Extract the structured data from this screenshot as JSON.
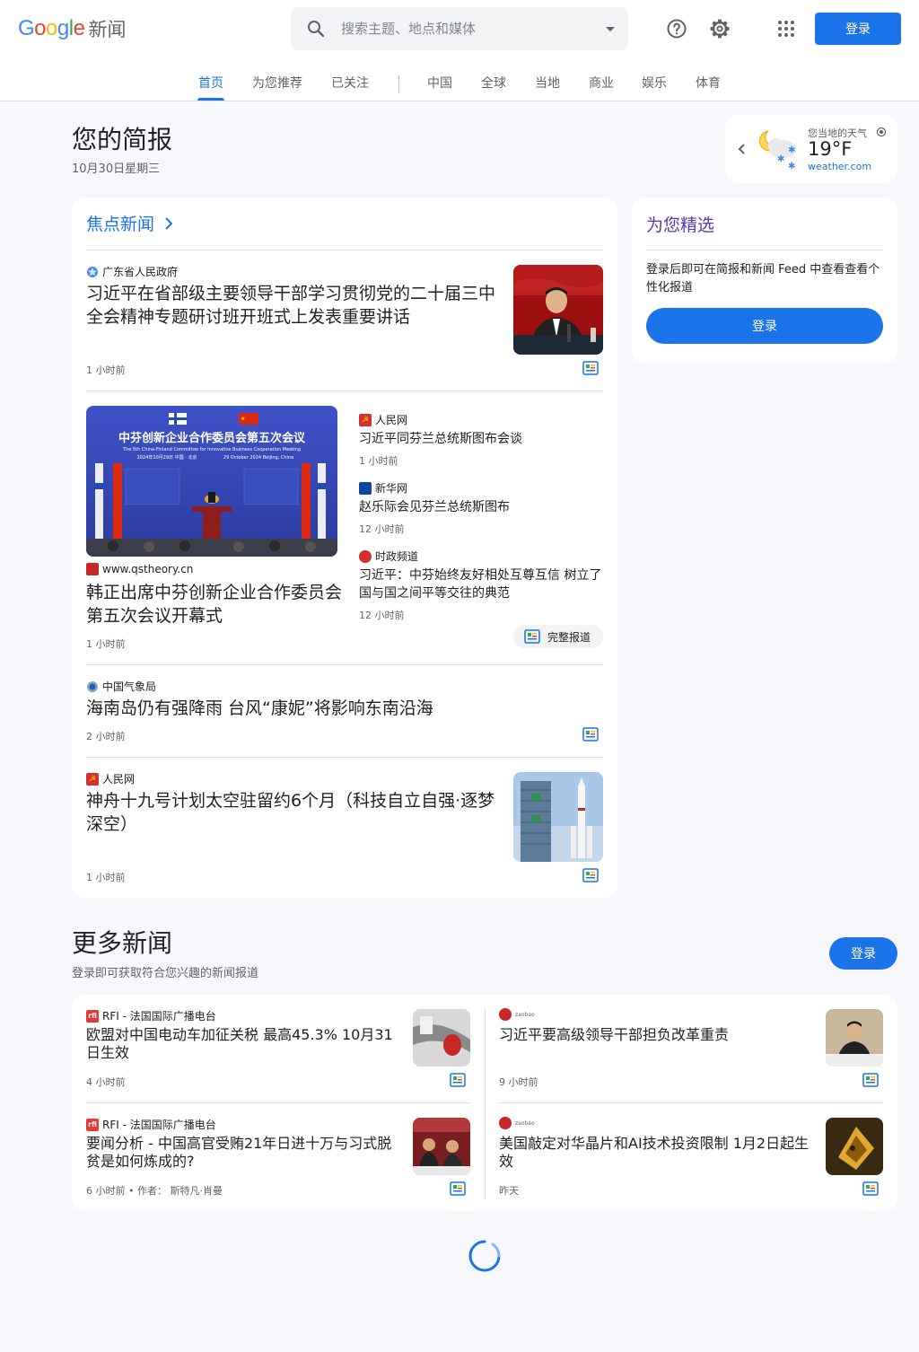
{
  "header": {
    "logo_word": "Google",
    "logo_suffix": "新闻",
    "search_placeholder": "搜索主题、地点和媒体",
    "signin_label": "登录",
    "icons": [
      "search-icon",
      "dropdown-caret-icon",
      "help-icon",
      "settings-icon",
      "apps-icon"
    ]
  },
  "tabs": [
    {
      "label": "首页",
      "active": true
    },
    {
      "label": "为您推荐"
    },
    {
      "label": "已关注"
    },
    {
      "label": "中国"
    },
    {
      "label": "全球"
    },
    {
      "label": "当地"
    },
    {
      "label": "商业"
    },
    {
      "label": "娱乐"
    },
    {
      "label": "体育"
    }
  ],
  "briefing": {
    "title": "您的简报",
    "date": "10月30日星期三"
  },
  "weather": {
    "label": "您当地的天气",
    "temp": "19°F",
    "source": "weather.com"
  },
  "top_stories": {
    "heading": "焦点新闻",
    "story1": {
      "source": "广东省人民政府",
      "headline": "习近平在省部级主要领导干部学习贯彻党的二十届三中全会精神专题研讨班开班式上发表重要讲话",
      "time": "1 小时前"
    },
    "story2": {
      "source": "www.qstheory.cn",
      "headline": "韩正出席中芬创新企业合作委员会第五次会议开幕式",
      "time": "1 小时前",
      "image_text": {
        "title_cn": "中芬创新企业合作委员会第五次会议",
        "title_en": "The 5th China-Finland Committee for Innovative Business Cooperation Meeting",
        "date_cn": "2024年10月29日  中国 · 北京",
        "date_en": "29 October 2024  Beijing, China"
      },
      "related": [
        {
          "source": "人民网",
          "headline": "习近平同芬兰总统斯图布会谈",
          "time": "1 小时前"
        },
        {
          "source": "新华网",
          "headline": "赵乐际会见芬兰总统斯图布",
          "time": "12 小时前"
        },
        {
          "source": "时政频道",
          "headline": "习近平：中芬始终友好相处互尊互信 树立了国与国之间平等交往的典范",
          "time": "12 小时前"
        }
      ],
      "full_coverage_label": "完整报道"
    },
    "story3": {
      "source": "中国气象局",
      "headline": "海南岛仍有强降雨 台风“康妮”将影响东南沿海",
      "time": "2 小时前"
    },
    "story4": {
      "source": "人民网",
      "headline": "神舟十九号计划太空驻留约6个月（科技自立自强·逐梦深空）",
      "time": "1 小时前"
    }
  },
  "picks": {
    "title": "为您精选",
    "text": "登录后即可在简报和新闻 Feed 中查看查看个性化报道",
    "button": "登录"
  },
  "more_news": {
    "title": "更多新闻",
    "subtitle": "登录即可获取符合您兴趣的新闻报道",
    "button": "登录",
    "items": [
      {
        "source": "RFI - 法国国际广播电台",
        "headline": "欧盟对中国电动车加征关税 最高45.3% 10月31日生效",
        "time": "4 小时前"
      },
      {
        "source": "zaobao",
        "headline": "习近平要高级领导干部担负改革重责",
        "time": "9 小时前"
      },
      {
        "source": "RFI - 法国国际广播电台",
        "headline": "要闻分析 - 中国高官受贿21年日进十万与习式脱贫是如何炼成的?",
        "time": "6 小时前 • 作者：  斯特凡·肖曼"
      },
      {
        "source": "zaobao",
        "headline": "美国敲定对华晶片和AI技术投资限制 1月2日起生效",
        "time": "昨天"
      }
    ]
  },
  "colors": {
    "accent": "#1a73e8",
    "picks_title": "#5e35b1",
    "background": "#f6f8fc"
  }
}
